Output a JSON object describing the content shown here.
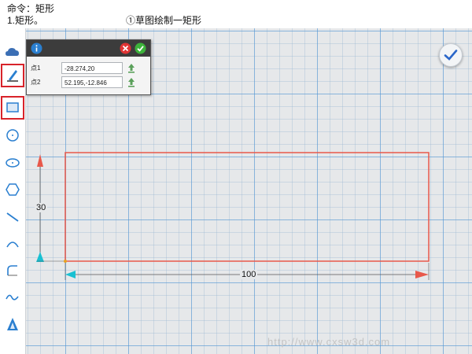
{
  "caption": {
    "line1": "命令：矩形",
    "line2": "1.矩形。",
    "step": "①草图绘制一矩形"
  },
  "toolbar": {
    "tools": [
      {
        "name": "cloud-icon"
      },
      {
        "name": "sketch-icon",
        "selected": true
      },
      {
        "name": "rectangle-icon",
        "selected": true
      },
      {
        "name": "circle-icon"
      },
      {
        "name": "ellipse-icon"
      },
      {
        "name": "polygon-icon"
      },
      {
        "name": "line-icon"
      },
      {
        "name": "arc-icon"
      },
      {
        "name": "fillet-icon"
      },
      {
        "name": "spline-icon"
      },
      {
        "name": "text-icon"
      }
    ]
  },
  "dialog": {
    "point1_label": "点1",
    "point1_value": "-28.274,20",
    "point2_label": "点2",
    "point2_value": "52.195,-12.846"
  },
  "dimensions": {
    "height": "30",
    "width": "100"
  },
  "colors": {
    "rectangle": "#e8584a",
    "accent": "#2a7fd0",
    "grid_major": "#5096d7"
  },
  "watermark": "http://www.cxsw3d.com"
}
